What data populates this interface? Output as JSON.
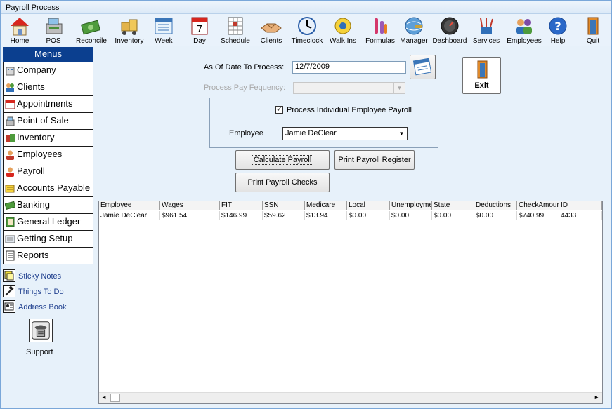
{
  "window": {
    "title": "Payroll Process"
  },
  "toolbar": [
    {
      "label": "Home",
      "icon": "home-icon"
    },
    {
      "label": "POS",
      "icon": "pos-icon"
    },
    {
      "label": "Reconcile",
      "icon": "reconcile-icon"
    },
    {
      "label": "Inventory",
      "icon": "inventory-icon"
    },
    {
      "label": "Week",
      "icon": "week-icon"
    },
    {
      "label": "Day",
      "icon": "day-icon"
    },
    {
      "label": "Schedule",
      "icon": "schedule-icon"
    },
    {
      "label": "Clients",
      "icon": "clients-icon"
    },
    {
      "label": "Timeclock",
      "icon": "timeclock-icon"
    },
    {
      "label": "Walk Ins",
      "icon": "walk-ins-icon"
    },
    {
      "label": "Formulas",
      "icon": "formulas-icon"
    },
    {
      "label": "Manager",
      "icon": "manager-icon"
    },
    {
      "label": "Dashboard",
      "icon": "dashboard-icon"
    },
    {
      "label": "Services",
      "icon": "services-icon"
    },
    {
      "label": "Employees",
      "icon": "employees-icon"
    },
    {
      "label": "Help",
      "icon": "help-icon"
    },
    {
      "label": "Quit",
      "icon": "quit-icon"
    }
  ],
  "sidebar": {
    "header": "Menus",
    "items": [
      {
        "label": "Company",
        "icon": "company-icon"
      },
      {
        "label": "Clients",
        "icon": "clients-icon"
      },
      {
        "label": "Appointments",
        "icon": "calendar-icon"
      },
      {
        "label": "Point of Sale",
        "icon": "register-icon"
      },
      {
        "label": "Inventory",
        "icon": "inventory-icon"
      },
      {
        "label": "Employees",
        "icon": "employee-icon"
      },
      {
        "label": "Payroll",
        "icon": "payroll-icon"
      },
      {
        "label": "Accounts Payable",
        "icon": "accounts-payable-icon"
      },
      {
        "label": "Banking",
        "icon": "banking-icon"
      },
      {
        "label": "General Ledger",
        "icon": "ledger-icon"
      },
      {
        "label": "Getting Setup",
        "icon": "setup-icon"
      },
      {
        "label": "Reports",
        "icon": "reports-icon"
      }
    ],
    "links": [
      {
        "label": "Sticky Notes",
        "icon": "sticky-note-icon"
      },
      {
        "label": "Things To Do",
        "icon": "hammer-icon"
      },
      {
        "label": "Address Book",
        "icon": "address-book-icon"
      }
    ],
    "support_label": "Support"
  },
  "form": {
    "date_label": "As Of Date To Process:",
    "date_value": "12/7/2009",
    "freq_label": "Process  Pay Fequency:",
    "freq_value": "",
    "individual_label": "Process Individual Employee Payroll",
    "individual_checked": true,
    "employee_label": "Employee",
    "employee_value": "Jamie DeClear",
    "exit_label": "Exit",
    "calc_label": "Calculate Payroll",
    "register_label": "Print Payroll Register",
    "checks_label": "Print Payroll Checks"
  },
  "grid": {
    "columns": [
      "Employee",
      "Wages",
      "FIT",
      "SSN",
      "Medicare",
      "Local",
      "Unemployment",
      "State",
      "Deductions",
      "CheckAmount",
      "ID"
    ],
    "rows": [
      [
        "Jamie DeClear",
        "$961.54",
        "$146.99",
        "$59.62",
        "$13.94",
        "$0.00",
        "$0.00",
        "$0.00",
        "$0.00",
        "$740.99",
        "4433"
      ]
    ]
  },
  "colors": {
    "menu_header": "#0b3f8f",
    "link_text": "#1f3f8e",
    "window_bg": "#e7f1fa"
  }
}
